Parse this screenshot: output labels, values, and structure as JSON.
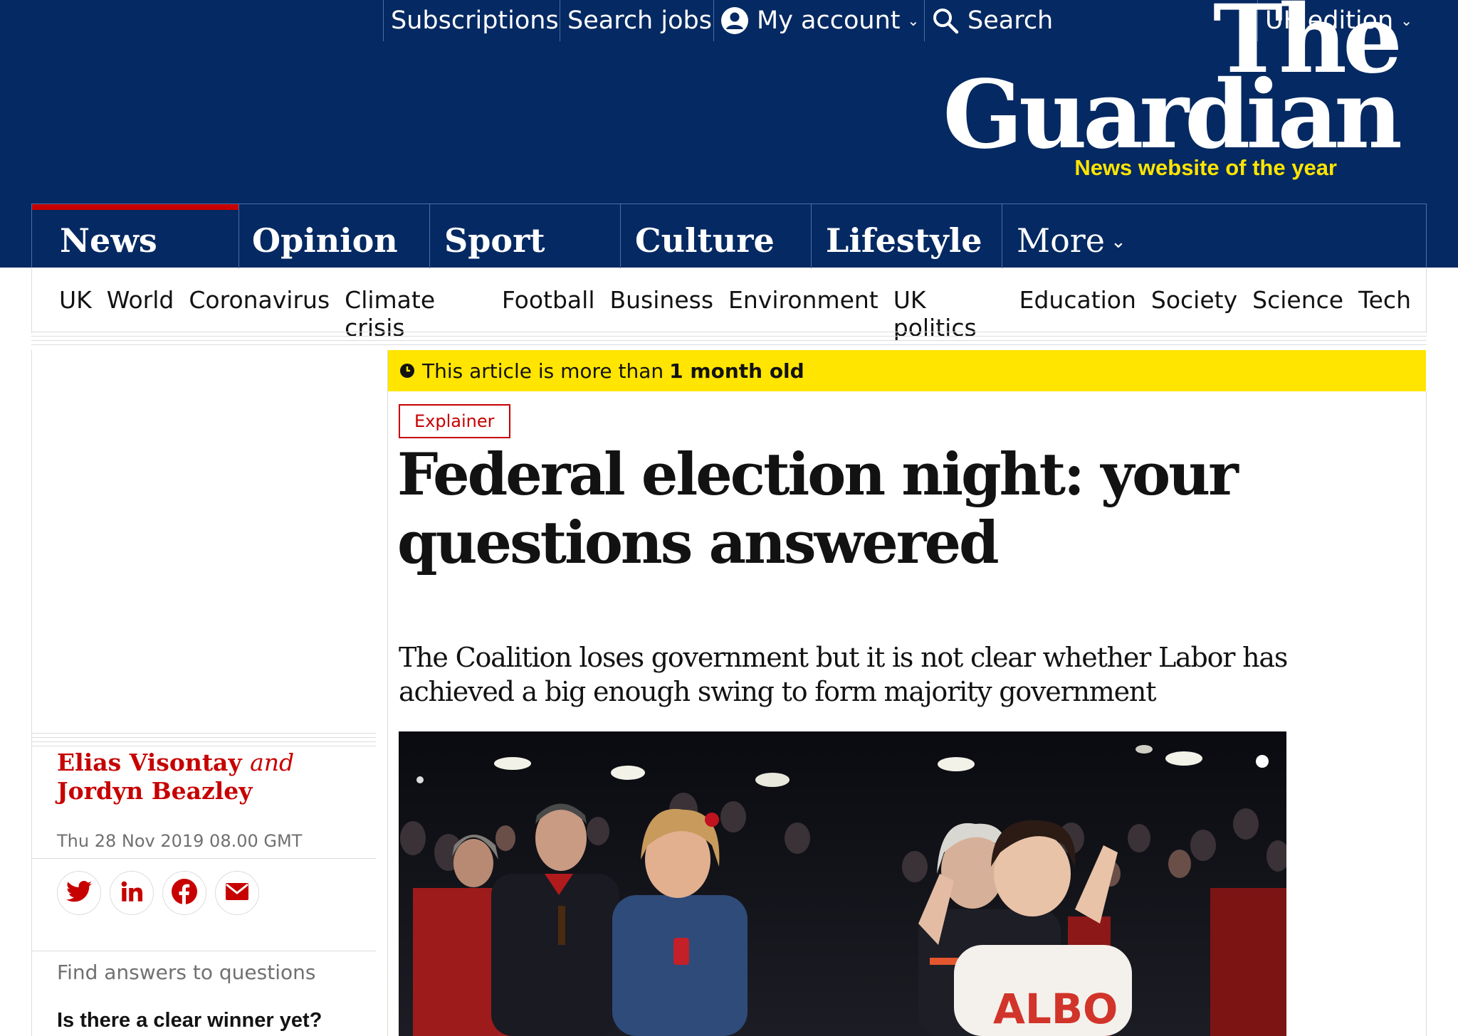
{
  "topnav": {
    "subscriptions": "Subscriptions",
    "search_jobs": "Search jobs",
    "my_account": "My account",
    "search": "Search",
    "edition": "UK edition"
  },
  "logo": {
    "line1": "The",
    "line2": "Guardian",
    "award": "News website of the year",
    "award_color": "#ffe500"
  },
  "pillars": [
    {
      "label": "News"
    },
    {
      "label": "Opinion"
    },
    {
      "label": "Sport"
    },
    {
      "label": "Culture"
    },
    {
      "label": "Lifestyle"
    },
    {
      "label": "More"
    }
  ],
  "subnav": [
    "UK",
    "World",
    "Coronavirus",
    "Climate crisis",
    "Football",
    "Business",
    "Environment",
    "UK politics",
    "Education",
    "Society",
    "Science",
    "Tech"
  ],
  "article": {
    "age_prefix": "This article is more than",
    "age_value": "1 month old",
    "kicker": "Explainer",
    "headline": "Federal election night: your questions answered",
    "standfirst": "The Coalition loses government but it is not clear whether Labor has achieved a big enough swing to form majority government",
    "byline_author1": "Elias Visontay",
    "byline_and": "and",
    "byline_author2": "Jordyn Beazley",
    "date": "Thu 28 Nov 2019 08.00 GMT",
    "find_answers": "Find answers to questions",
    "first_question": "Is there a clear winner yet?",
    "photo_shirt_text": "ALBO"
  },
  "share": [
    "twitter-icon",
    "linkedin-icon",
    "facebook-icon",
    "email-icon"
  ],
  "colors": {
    "brand_blue": "#052962",
    "news_red": "#c70000",
    "banner_yellow": "#ffe500"
  }
}
